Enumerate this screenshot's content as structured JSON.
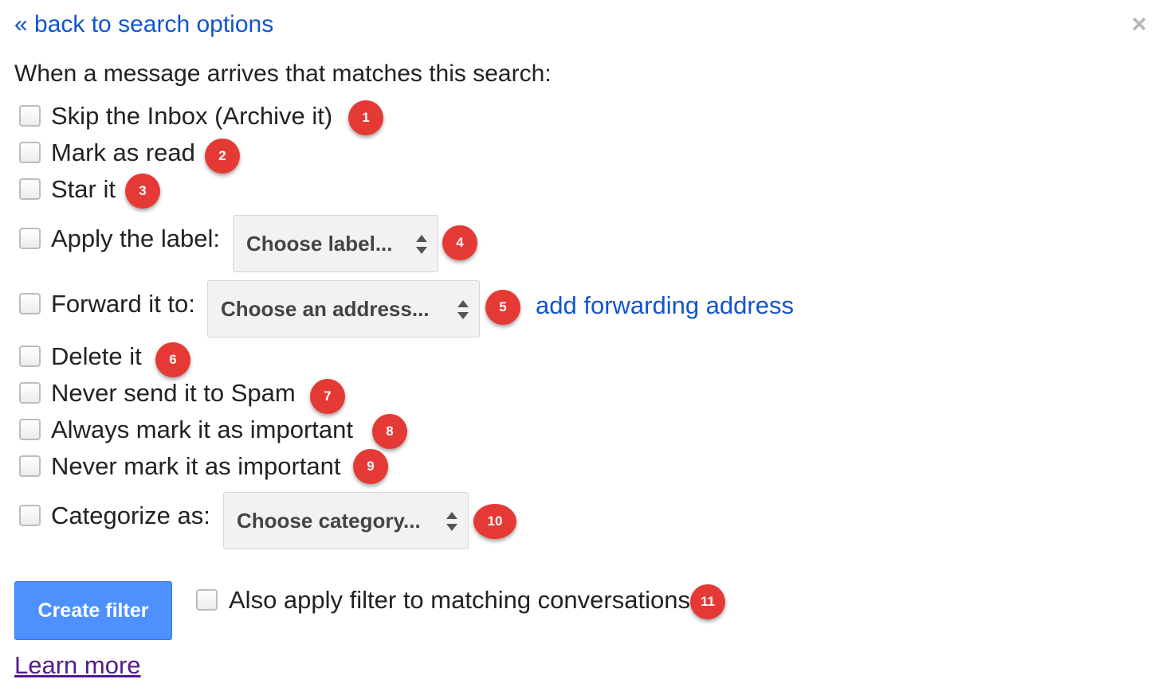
{
  "back_link": "« back to search options",
  "close_glyph": "×",
  "intro": "When a message arrives that matches this search:",
  "options": {
    "skip_inbox": "Skip the Inbox (Archive it)",
    "mark_read": "Mark as read",
    "star_it": "Star it",
    "apply_label": "Apply the label:",
    "forward_to": "Forward it to:",
    "delete_it": "Delete it",
    "never_spam": "Never send it to Spam",
    "always_important": "Always mark it as important",
    "never_important": "Never mark it as important",
    "categorize": "Categorize as:"
  },
  "selects": {
    "label": "Choose label...",
    "address": "Choose an address...",
    "category": "Choose category..."
  },
  "add_forwarding": "add forwarding address",
  "create_filter": "Create filter",
  "also_apply": "Also apply filter to matching conversations.",
  "learn_more": "Learn more",
  "badges": [
    "1",
    "2",
    "3",
    "4",
    "5",
    "6",
    "7",
    "8",
    "9",
    "10",
    "11"
  ],
  "colors": {
    "link": "#1155cc",
    "badge": "#e53935",
    "button": "#4d90fe",
    "visited_link": "#551a8b"
  },
  "icons": {
    "close": "close-icon",
    "select_arrows": "up-down-arrows-icon"
  }
}
